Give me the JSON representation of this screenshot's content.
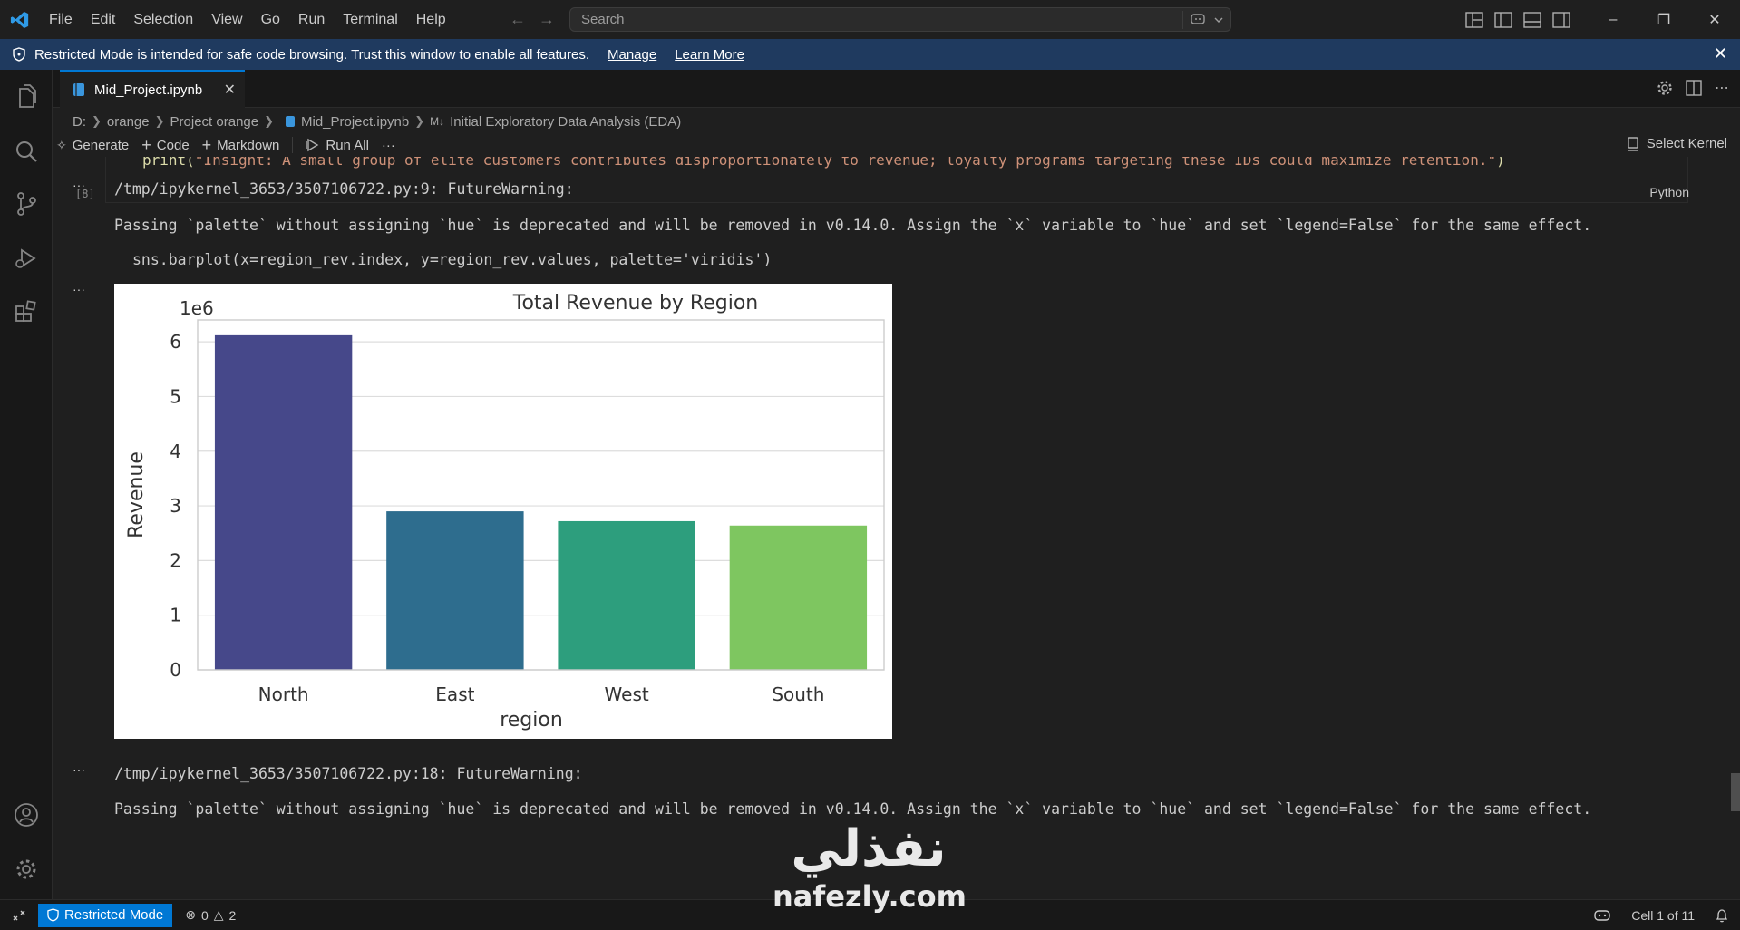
{
  "menu": [
    "File",
    "Edit",
    "Selection",
    "View",
    "Go",
    "Run",
    "Terminal",
    "Help"
  ],
  "search": {
    "placeholder": "Search"
  },
  "banner": {
    "text": "Restricted Mode is intended for safe code browsing. Trust this window to enable all features.",
    "manage": "Manage",
    "learn_more": "Learn More"
  },
  "tab": {
    "label": "Mid_Project.ipynb"
  },
  "breadcrumb": [
    "D:",
    "orange",
    "Project orange",
    "Mid_Project.ipynb",
    "Initial Exploratory Data Analysis (EDA)"
  ],
  "toolbar": {
    "generate": "Generate",
    "code": "Code",
    "markdown": "Markdown",
    "run_all": "Run All",
    "more": "···",
    "select_kernel": "Select Kernel"
  },
  "cell": {
    "code_text_fn": "print(",
    "code_text_str": "\"Insight: A small group of elite customers contributes disproportionately to revenue; loyalty programs targeting these IDs could maximize retention.\"",
    "code_text_end": ")",
    "exec_count": "[8]",
    "language": "Python"
  },
  "output": {
    "ellipsis": "···",
    "warning1_path": "/tmp/ipykernel_3653/3507106722.py:9: FutureWarning:",
    "warning_msg": "Passing `palette` without assigning `hue` is deprecated and will be removed in v0.14.0. Assign the `x` variable to `hue` and set `legend=False` for the same effect.",
    "code_line": "sns.barplot(x=region_rev.index, y=region_rev.values, palette='viridis')",
    "warning2_path": "/tmp/ipykernel_3653/3507106722.py:18: FutureWarning:",
    "warning2_msg": "Passing `palette` without assigning `hue` is deprecated and will be removed in v0.14.0. Assign the `x` variable to `hue` and set `legend=False` for the same effect."
  },
  "chart_data": {
    "type": "bar",
    "title": "Total Revenue by Region",
    "xlabel": "region",
    "ylabel": "Revenue",
    "scale_label": "1e6",
    "categories": [
      "North",
      "East",
      "West",
      "South"
    ],
    "values": [
      6120000,
      2900000,
      2720000,
      2640000
    ],
    "colors": [
      "#46488a",
      "#2e6d8e",
      "#2d9e7d",
      "#7ec660"
    ],
    "yticks": [
      "0",
      "1",
      "2",
      "3",
      "4",
      "5",
      "6"
    ],
    "ylim": [
      0,
      6.4
    ],
    "grid": true
  },
  "status": {
    "restricted": "Restricted Mode",
    "errors": "0",
    "warnings": "2",
    "cell_position": "Cell 1 of 11"
  },
  "watermark": {
    "arabic": "نفذلي",
    "url": "nafezly.com"
  }
}
